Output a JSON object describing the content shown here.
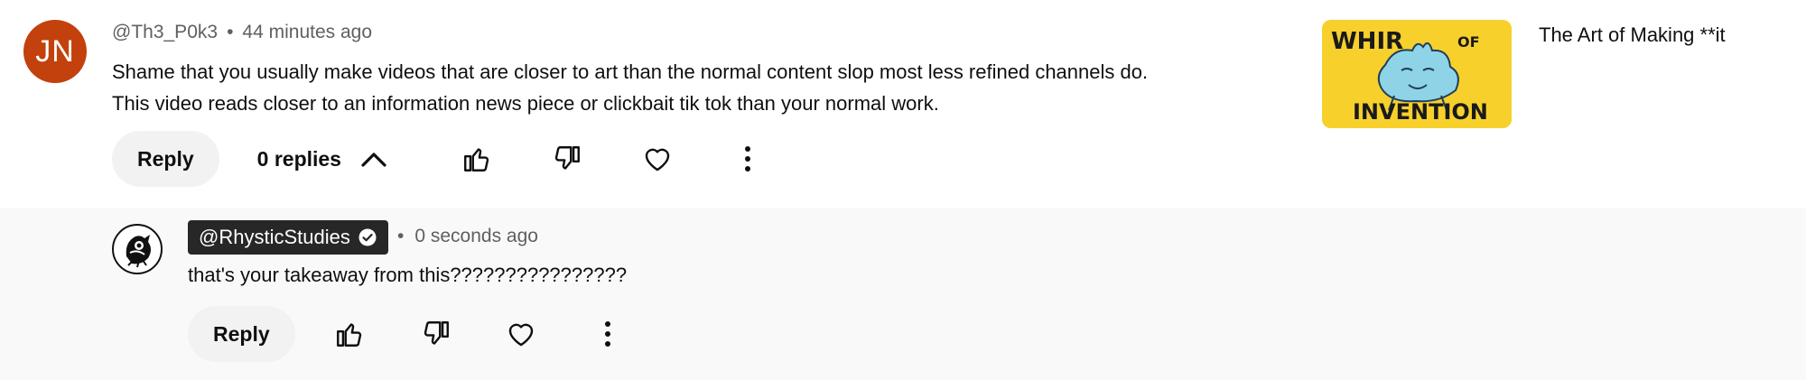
{
  "comment": {
    "avatar_initials": "JN",
    "author": "@Th3_P0k3",
    "separator": "•",
    "time": "44 minutes ago",
    "text": "Shame that you usually make videos that are closer to art than the normal content slop most less refined channels do. This video reads closer to an information news piece or clickbait tik tok than your normal work.",
    "reply_label": "Reply",
    "replies_label": "0 replies",
    "replies_icon": "chevron-up-icon"
  },
  "video": {
    "title": "The Art of Making **it",
    "thumbnail": {
      "background": "#f7d02c",
      "lines": [
        "WHIR",
        "OF",
        "INVENTION"
      ]
    }
  },
  "reply": {
    "author": "@RhysticStudies",
    "verified_icon": "verified-check-icon",
    "separator": "•",
    "time": "0 seconds ago",
    "text": "that's your takeaway from this????????????????",
    "reply_label": "Reply"
  },
  "icons": {
    "like": "thumbs-up-icon",
    "dislike": "thumbs-down-icon",
    "heart": "heart-icon",
    "more": "more-vert-icon"
  },
  "colors": {
    "avatar_bg": "#c2410c",
    "chip_bg": "#272727",
    "reply_area_bg": "#f9f9f9",
    "button_bg": "#f2f2f2"
  }
}
